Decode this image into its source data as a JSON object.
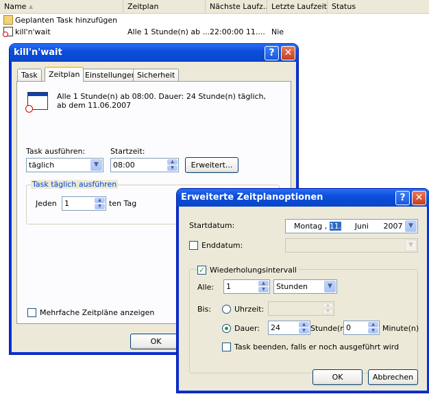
{
  "explorer": {
    "columns": {
      "name": "Name",
      "schedule": "Zeitplan",
      "next_run": "Nächste Laufz...",
      "last_run": "Letzte Laufzeit",
      "status": "Status"
    },
    "rows": [
      {
        "name": "Geplanten Task hinzufügen",
        "schedule": "",
        "next_run": "",
        "last_run": "",
        "status": ""
      },
      {
        "name": "kill'n'wait",
        "schedule": "Alle 1 Stunde(n) ab ...",
        "next_run": "22:00:00  11....",
        "last_run": "Nie",
        "status": ""
      }
    ]
  },
  "task_dialog": {
    "title": "kill'n'wait",
    "help": "?",
    "close": "✕",
    "tabs": [
      "Task",
      "Zeitplan",
      "Einstellungen",
      "Sicherheit"
    ],
    "summary": "Alle 1 Stunde(n) ab 08:00. Dauer: 24 Stunde(n) täglich, ab dem 11.06.2007",
    "run_label": "Task ausführen:",
    "run_value": "täglich",
    "start_label": "Startzeit:",
    "start_value": "08:00",
    "advanced_button": "Erweitert...",
    "daily_group": "Task täglich ausführen",
    "every_label": "Jeden",
    "every_value": "1",
    "every_unit": "ten Tag",
    "multi_label": "Mehrfache Zeitpläne anzeigen",
    "ok_button": "OK"
  },
  "advanced_dialog": {
    "title": "Erweiterte Zeitplanoptionen",
    "help": "?",
    "close": "✕",
    "start_date_label": "Startdatum:",
    "start_date": {
      "weekday": "Montag",
      "sep": ",",
      "day": "11.",
      "month": "Juni",
      "year": "2007"
    },
    "end_date_label": "Enddatum:",
    "repeat_label": "Wiederholungsintervall",
    "every_label": "Alle:",
    "every_value": "1",
    "every_unit": "Stunden",
    "until_label": "Bis:",
    "time_label": "Uhrzeit:",
    "duration_label": "Dauer:",
    "duration_hours": "24",
    "hours_unit": "Stunde(n)",
    "duration_minutes": "0",
    "minutes_unit": "Minute(n)",
    "stop_label": "Task beenden, falls er noch ausgeführt wird",
    "ok_button": "OK",
    "cancel_button": "Abbrechen"
  }
}
